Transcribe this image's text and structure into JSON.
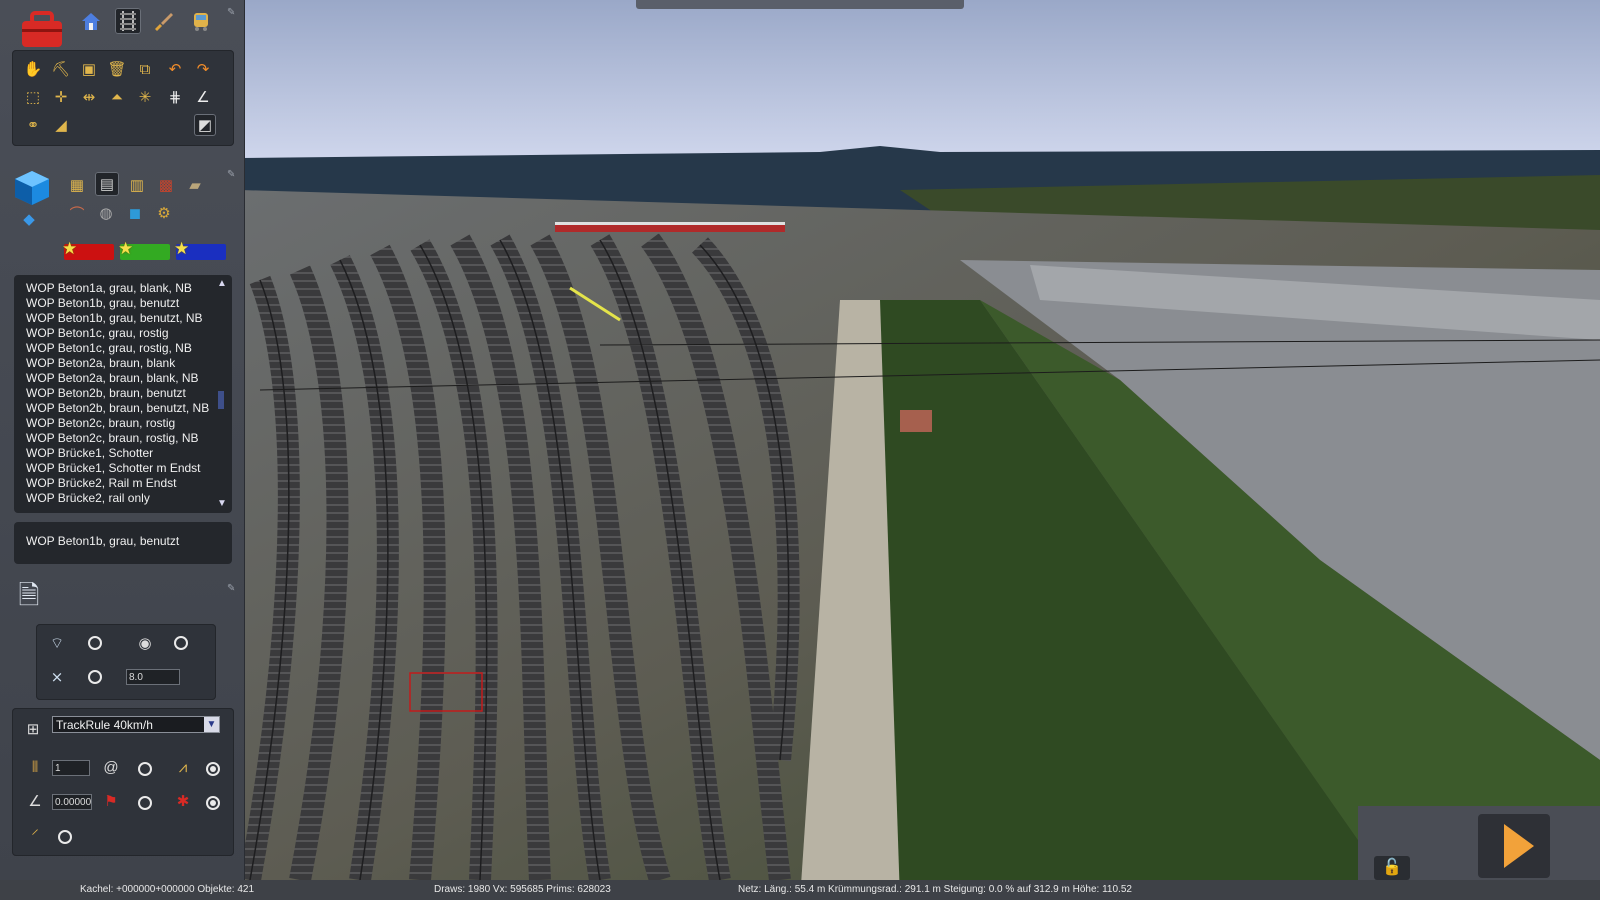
{
  "asset_list": {
    "items": [
      "WOP Beton1a, grau, blank, NB",
      "WOP Beton1b, grau, benutzt",
      "WOP Beton1b, grau, benutzt, NB",
      "WOP Beton1c, grau, rostig",
      "WOP Beton1c, grau, rostig, NB",
      "WOP Beton2a, braun, blank",
      "WOP Beton2a, braun, blank, NB",
      "WOP Beton2b, braun, benutzt",
      "WOP Beton2b, braun, benutzt, NB",
      "WOP Beton2c, braun, rostig",
      "WOP Beton2c, braun, rostig, NB",
      "WOP Brücke1, Schotter",
      "WOP Brücke1, Schotter m Endst",
      "WOP Brücke2, Rail m Endst",
      "WOP Brücke2, rail only"
    ]
  },
  "selected_asset": "WOP Beton1b, grau, benutzt",
  "spline_options": {
    "height_value": "8.0"
  },
  "track_rule": {
    "selected": "TrackRule 40km/h",
    "count_value": "1",
    "grade_value": "0.00000"
  },
  "colors": {
    "swatch_red": "#cc1111",
    "swatch_green": "#33aa22",
    "swatch_blue": "#1a2fc0",
    "accent_play": "#f2a23a"
  },
  "status_bar": {
    "tile_info": "Kachel: +000000+000000  Objekte: 421",
    "render_info": "Draws: 1980 Vx: 595685 Prims: 628023",
    "net_info": "Netz:  Läng.:  55.4 m Krümmungsrad.: 291.1 m Steigung:  0.0 % auf 312.9 m Höhe: 110.52"
  },
  "icons": {
    "toolbox": "toolbox-icon",
    "home": "home-icon",
    "track": "track-icon",
    "paint": "brush-icon",
    "train": "train-icon",
    "play": "play-icon",
    "lock": "unlock-icon"
  }
}
